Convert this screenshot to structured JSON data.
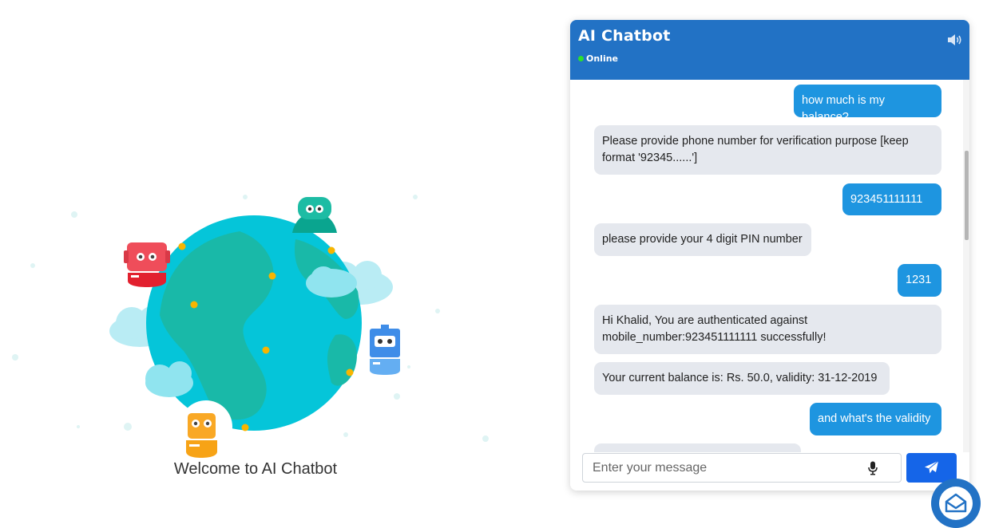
{
  "welcome": {
    "text": "Welcome to AI Chatbot"
  },
  "chat": {
    "title": "AI Chatbot",
    "status": "Online",
    "input_placeholder": "Enter your message",
    "messages": [
      {
        "from": "user",
        "text": "how much is my balance?"
      },
      {
        "from": "bot",
        "text": "Please provide phone number for verification purpose [keep format '92345......']"
      },
      {
        "from": "user",
        "text": "923451111111"
      },
      {
        "from": "bot",
        "text": "please provide your 4 digit PIN number"
      },
      {
        "from": "user",
        "text": "1231"
      },
      {
        "from": "bot",
        "text": "Hi Khalid, You are authenticated against mobile_number:923451111111 successfully!"
      },
      {
        "from": "bot",
        "text": "Your current balance is: Rs. 50.0, validity: 31-12-2019"
      },
      {
        "from": "user",
        "text": "and what's the validity"
      },
      {
        "from": "bot",
        "text": ""
      }
    ]
  },
  "icons": {
    "speaker": "speaker-icon",
    "mic": "microphone-icon",
    "send": "paper-plane-icon",
    "launcher": "chat-launcher-icon"
  },
  "colors": {
    "header": "#2272c5",
    "user_bubble": "#1e95e0",
    "bot_bubble": "#e5e8ee",
    "send_button": "#1565e8",
    "online_dot": "#2ce02c"
  }
}
